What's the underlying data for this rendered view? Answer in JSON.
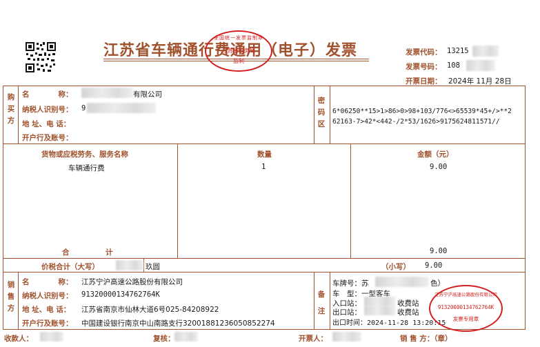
{
  "header": {
    "title": "江苏省车辆通行费通用（电子）发票",
    "code_label": "发票代码：",
    "code_value": "13215",
    "number_label": "发票号码：",
    "number_value": "108",
    "date_label": "开票日期：",
    "date_value": "2024年 11月 28日"
  },
  "buyer": {
    "section": [
      "购",
      "买",
      "方"
    ],
    "name_label": "名　　　　称：",
    "name_value": "有限公司",
    "tax_label": "纳税人识别号：",
    "tax_value": "9",
    "addr_label": "地 址、电 话：",
    "bank_label": "开户行及账号："
  },
  "cipher": {
    "section": [
      "密",
      "码",
      "区"
    ],
    "line1": "6*06250**15>1>86>0>98+103/776<>65539*45+/>**2",
    "line2": "62163-7>42*<442-/2*53/1626>9175624811571//"
  },
  "items": {
    "head_name": "货物或应税劳务、服务名称",
    "head_qty": "数量",
    "head_amount": "金额（元）",
    "row_name": "车辆通行费",
    "row_qty": "1",
    "row_amount": "9.00",
    "total_label": "合　　　　　计",
    "total_amount": "9.00"
  },
  "grand_total": {
    "label": "价税合计（大写）",
    "words": "玖圆",
    "small_label": "（小写）",
    "small_value": "9.00"
  },
  "seller": {
    "section": [
      "销",
      "售",
      "方"
    ],
    "name_label": "名　　　　称：",
    "name_value": "江苏宁沪高速公路股份有限公司",
    "tax_label": "纳税人识别号：",
    "tax_value": "91320000134762764K",
    "addr_label": "地 址、电 话：",
    "addr_value": "江苏省南京市仙林大道6号025-84208922",
    "bank_label": "开户行及账号：",
    "bank_value": "中国建设银行南京中山南路支行32001881236050852274"
  },
  "remarks": {
    "section": [
      "备",
      "注"
    ],
    "plate": "车牌号：苏",
    "plate_tail": "色）",
    "vtype": "车　型：一型客车",
    "entry": "入口站：",
    "entry_tail": "收费站",
    "exit": "出口站：",
    "exit_tail": "收费站",
    "exit_time": "出口时间：2024-11-28 13:20:15"
  },
  "footer": {
    "payee": "收款人：",
    "reviewer": "复核：",
    "issuer": "开票人：",
    "seller_seal": "销 售 方：（章）"
  },
  "seals": {
    "top_text": "江苏省税务局",
    "top_sub": "监制",
    "top_arc": "全国统一发票监制章",
    "seller_arc": "江苏宁沪高速公路股份有限公司",
    "seller_tax": "91320000134762764K",
    "seller_sub": "发票专用章"
  },
  "colors": {
    "frame": "#a0522d",
    "stamp": "#d21f1f"
  }
}
